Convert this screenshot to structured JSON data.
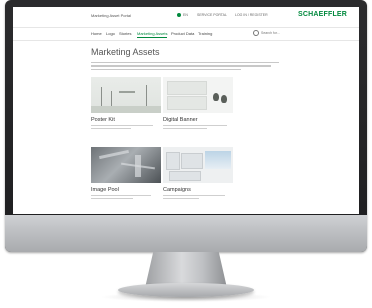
{
  "header": {
    "portal_title": "Marketing Asset Portal",
    "util_items": [
      "EN",
      "SERVICE PORTAL",
      "LOG IN / REGISTER"
    ],
    "logo": "SCHAEFFLER"
  },
  "nav": {
    "items": [
      {
        "label": "Home"
      },
      {
        "label": "Logo"
      },
      {
        "label": "Stories"
      },
      {
        "label": "Marketing Assets"
      },
      {
        "label": "Product Data"
      },
      {
        "label": "Training"
      }
    ],
    "active": "Marketing Assets",
    "search_placeholder": "Search for..."
  },
  "page": {
    "title": "Marketing Assets"
  },
  "cards": [
    {
      "name": "Poster Kit"
    },
    {
      "name": "Digital Banner"
    },
    {
      "name": "Image Pool"
    },
    {
      "name": "Campaigns"
    }
  ],
  "colors": {
    "brand": "#00893d",
    "bezel": "#1e1e20",
    "chin": "#b7b9bc"
  }
}
